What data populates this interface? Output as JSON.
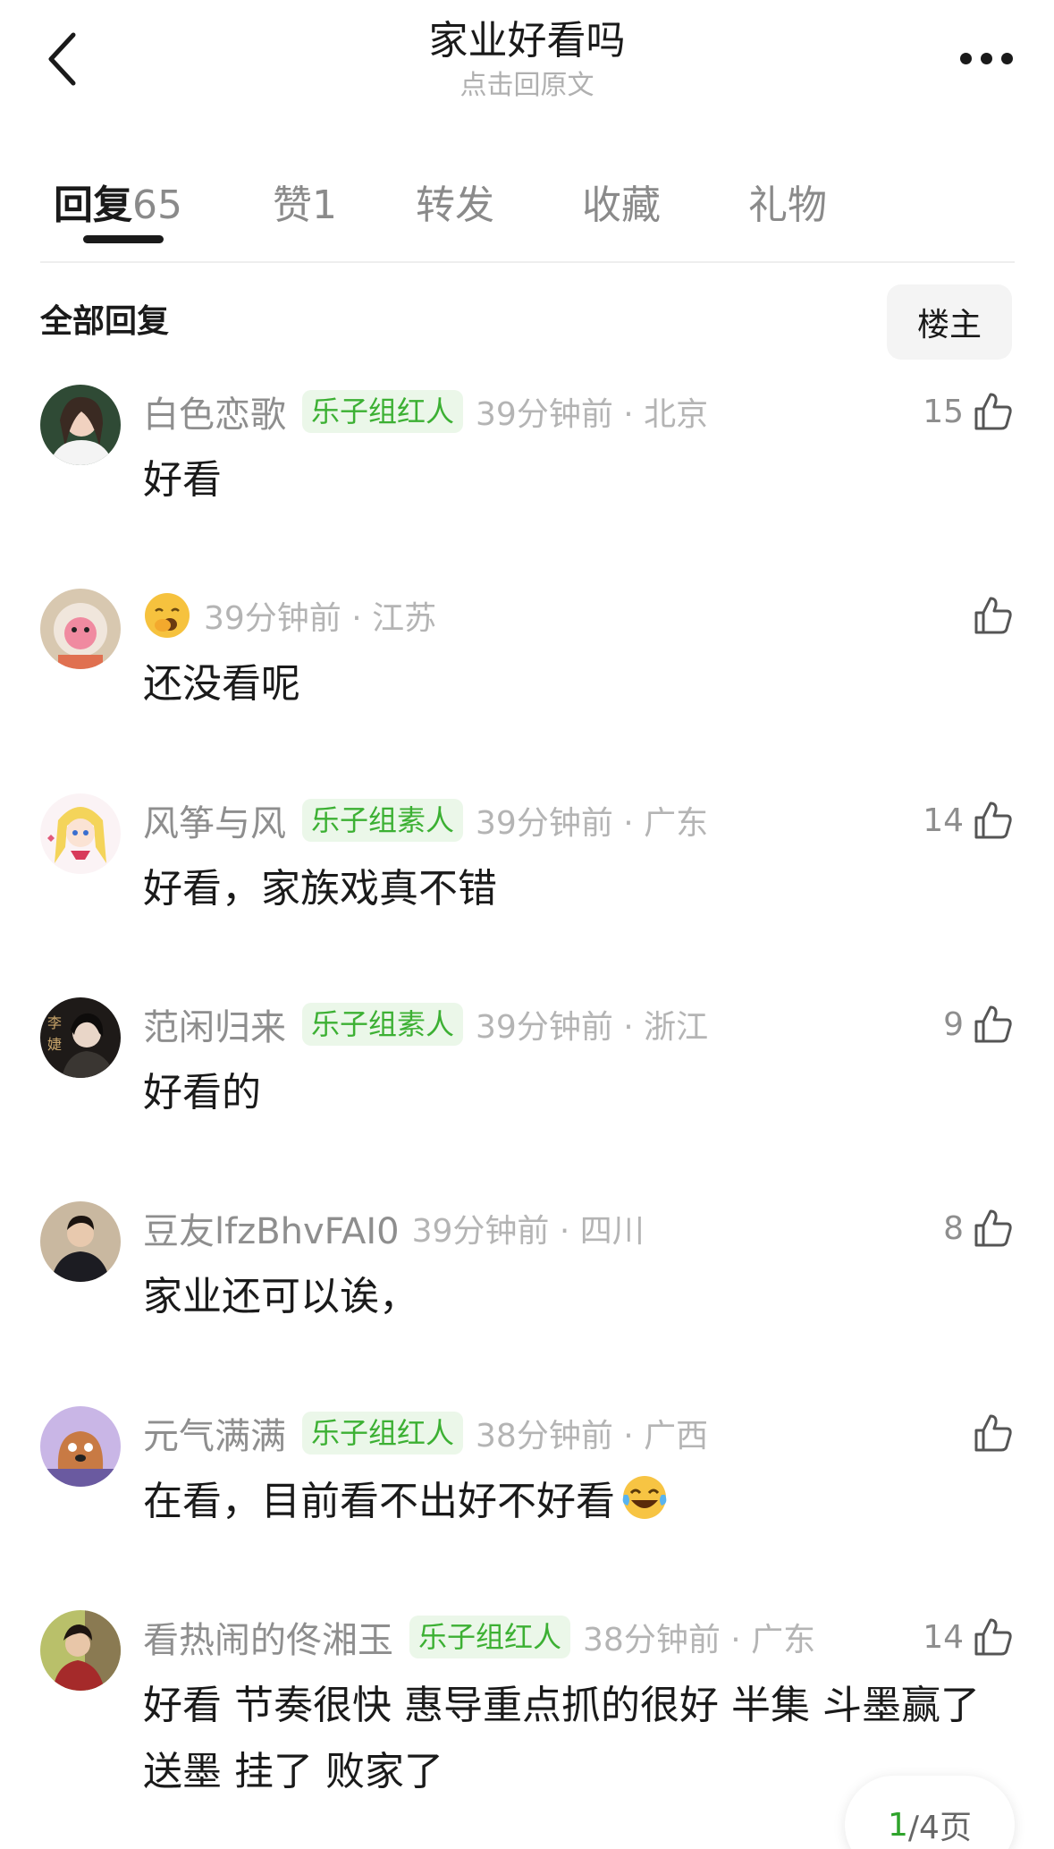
{
  "header": {
    "title": "家业好看吗",
    "subtitle": "点击回原文"
  },
  "tabs": [
    {
      "label": "回复",
      "count": "65",
      "active": true
    },
    {
      "label": "赞",
      "count": "1",
      "active": false
    },
    {
      "label": "转发",
      "count": "",
      "active": false
    },
    {
      "label": "收藏",
      "count": "",
      "active": false
    },
    {
      "label": "礼物",
      "count": "",
      "active": false
    }
  ],
  "section": {
    "title": "全部回复",
    "filter_label": "楼主"
  },
  "comments": [
    {
      "name": "白色恋歌",
      "badge": "乐子组红人",
      "time": "39分钟前 · 北京",
      "likes": "15",
      "text": "好看"
    },
    {
      "name": "",
      "name_icon": "yawning-face-emoji-icon",
      "badge": "",
      "time": "39分钟前 · 江苏",
      "likes": "",
      "text": "还没看呢"
    },
    {
      "name": "风筝与风",
      "badge": "乐子组素人",
      "time": "39分钟前 · 广东",
      "likes": "14",
      "text": "好看，家族戏真不错"
    },
    {
      "name": "范闲归来",
      "badge": "乐子组素人",
      "time": "39分钟前 · 浙江",
      "likes": "9",
      "text": "好看的"
    },
    {
      "name": "豆友lfzBhvFAI0",
      "badge": "",
      "time": "39分钟前 · 四川",
      "likes": "8",
      "text": "家业还可以诶，"
    },
    {
      "name": "元气满满",
      "badge": "乐子组红人",
      "time": "38分钟前 · 广西",
      "likes": "",
      "text": "在看，目前看不出好不好看",
      "text_icon": "tears-of-joy-emoji-icon"
    },
    {
      "name": "看热闹的佟湘玉",
      "badge": "乐子组红人",
      "time": "38分钟前 · 广东",
      "likes": "14",
      "text": "好看  节奏很快  惠导重点抓的很好  半集  斗墨赢了 送墨 挂了  败家了"
    }
  ],
  "pager": {
    "current": "1",
    "total_text": "/4页"
  },
  "colors": {
    "badge_green": "#3cb033",
    "badge_bg": "#ebf7e9",
    "pager_current": "#2fa42c"
  }
}
